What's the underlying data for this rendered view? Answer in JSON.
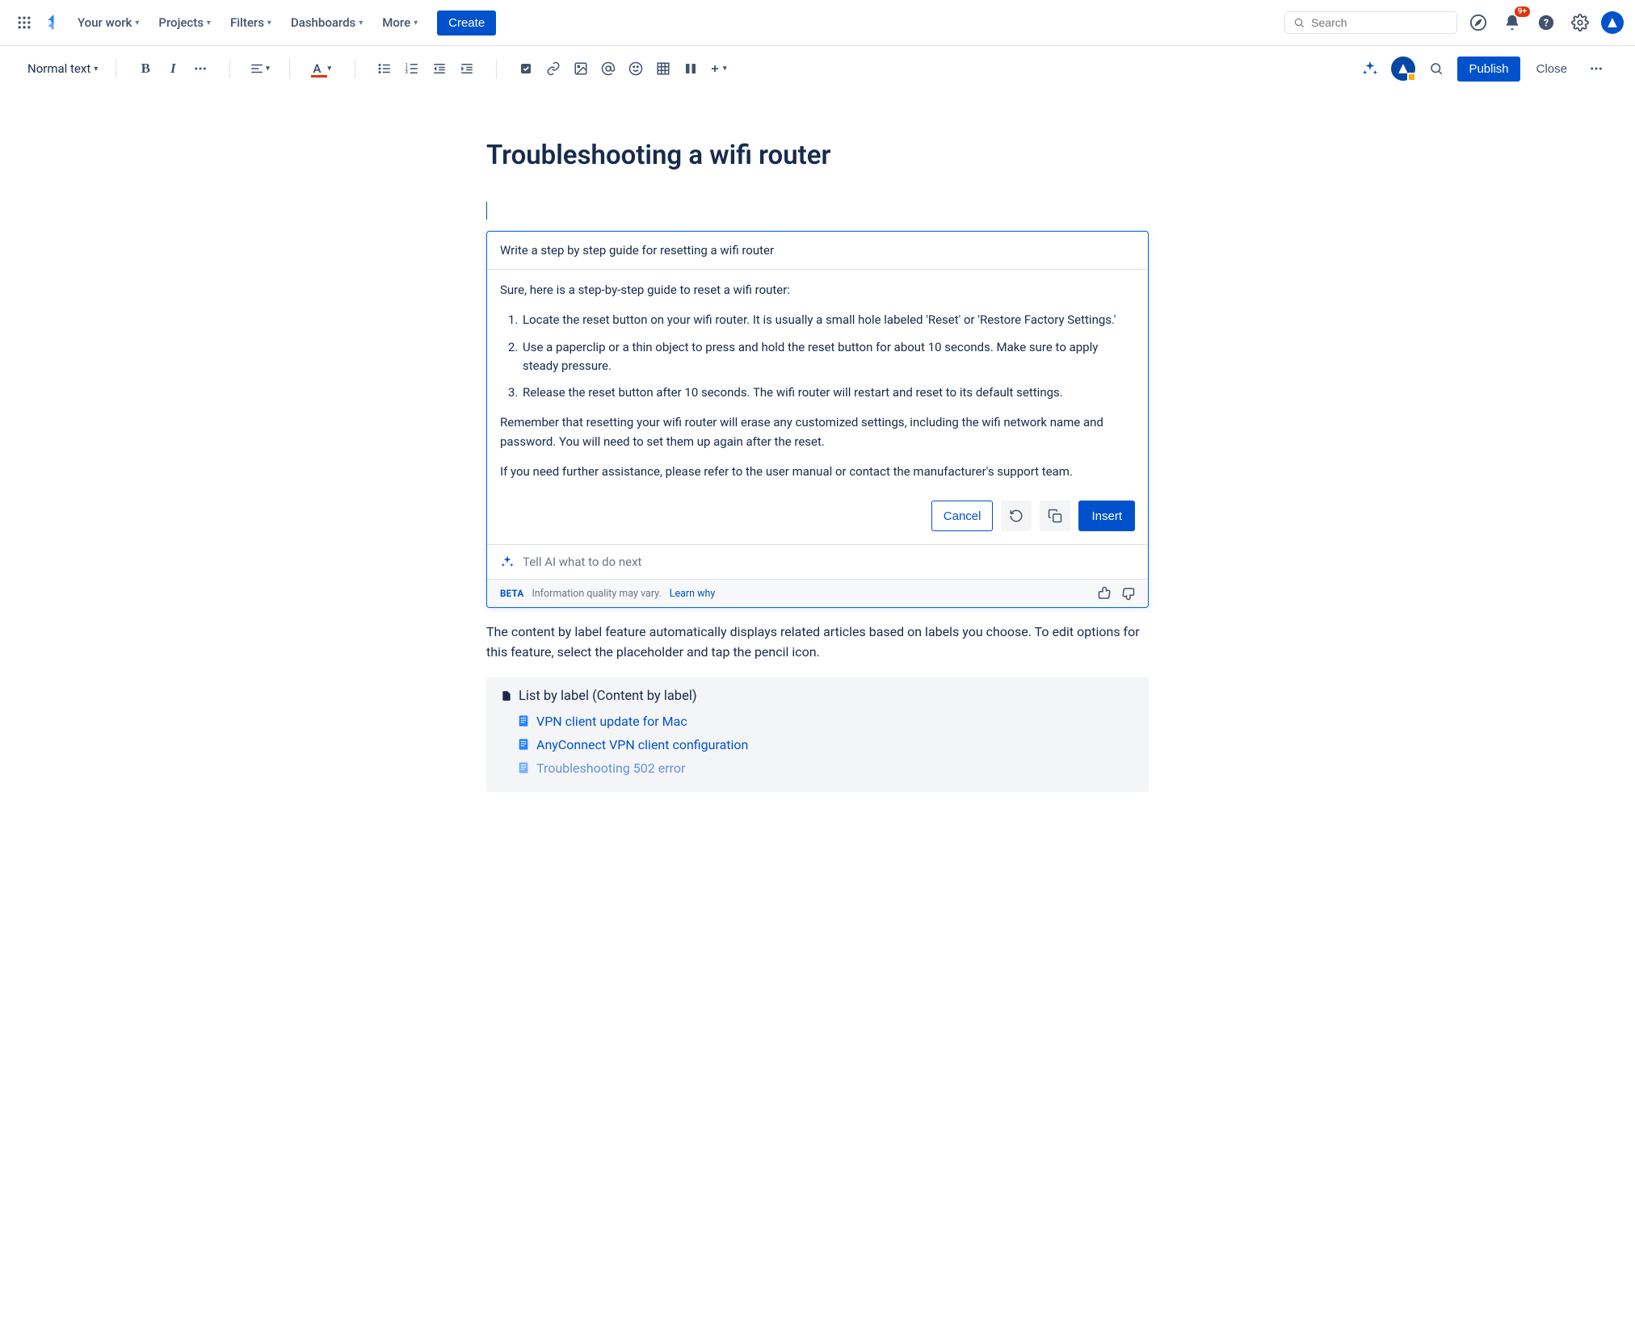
{
  "topnav": {
    "items": [
      "Your work",
      "Projects",
      "Filters",
      "Dashboards",
      "More"
    ],
    "create": "Create",
    "search_placeholder": "Search",
    "notif_badge": "9+"
  },
  "editor": {
    "text_style": "Normal text",
    "publish": "Publish",
    "close": "Close"
  },
  "page": {
    "title": "Troubleshooting a wifi router"
  },
  "ai": {
    "prompt": "Write a step by step guide for resetting a wifi router",
    "intro": "Sure, here is a step-by-step guide to reset a wifi router:",
    "steps": [
      "Locate the reset button on your wifi router. It is usually a small hole labeled 'Reset' or 'Restore Factory Settings.'",
      "Use a paperclip or a thin object to press and hold the reset button for about 10 seconds. Make sure to apply steady pressure.",
      "Release the reset button after 10 seconds. The wifi router will restart and reset to its default settings."
    ],
    "note1": "Remember that resetting your wifi router will erase any customized settings, including the wifi network name and password. You will need to set them up again after the reset.",
    "note2": "If you need further assistance, please refer to the user manual or contact the manufacturer's support team.",
    "cancel": "Cancel",
    "insert": "Insert",
    "followup_placeholder": "Tell AI what to do next",
    "beta": "BETA",
    "disclaimer": "Information quality may vary.",
    "learn": "Learn why"
  },
  "body_para": "The content by label feature automatically displays related articles based on labels you choose. To edit options for this feature, select the placeholder and tap the pencil icon.",
  "macro": {
    "title": "List by label (Content by label)",
    "items": [
      "VPN client update for Mac",
      "AnyConnect VPN client configuration",
      "Troubleshooting 502 error"
    ]
  }
}
